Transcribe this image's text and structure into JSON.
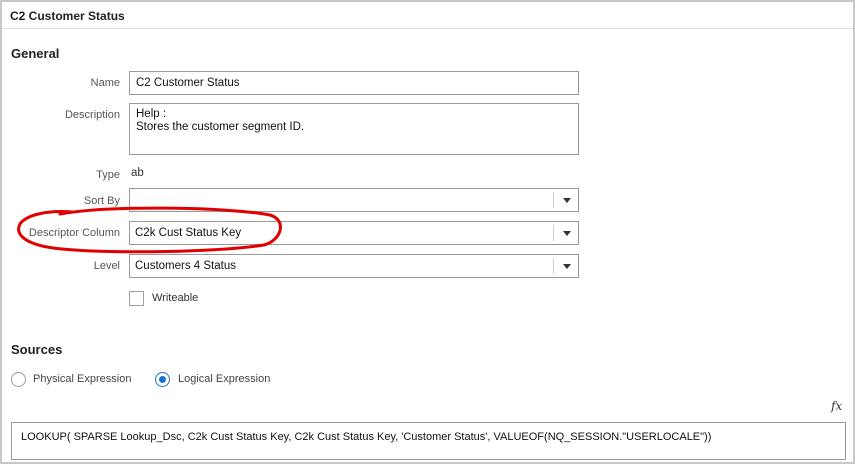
{
  "window": {
    "title": "C2 Customer Status"
  },
  "general": {
    "heading": "General",
    "name": {
      "label": "Name",
      "value": "C2  Customer Status"
    },
    "description": {
      "label": "Description",
      "lines": [
        "Help :",
        "Stores the customer segment ID."
      ]
    },
    "type": {
      "label": "Type",
      "value": "ab"
    },
    "sort_by": {
      "label": "Sort By",
      "value": ""
    },
    "descriptor_column": {
      "label": "Descriptor Column",
      "value": "C2k  Cust Status Key"
    },
    "level": {
      "label": "Level",
      "value": "Customers 4 Status"
    },
    "writeable": {
      "label": "Writeable",
      "checked": false
    }
  },
  "sources": {
    "heading": "Sources",
    "options": [
      {
        "label": "Physical Expression",
        "selected": false
      },
      {
        "label": "Logical Expression",
        "selected": true
      }
    ],
    "fx_icon": "fx",
    "expression": "LOOKUP( SPARSE Lookup_Dsc, C2k  Cust Status Key, C2k  Cust Status Key, 'Customer Status',  VALUEOF(NQ_SESSION.\"USERLOCALE\"))"
  },
  "colors": {
    "accent": "#1a73c8",
    "annotation": "#e00000"
  }
}
